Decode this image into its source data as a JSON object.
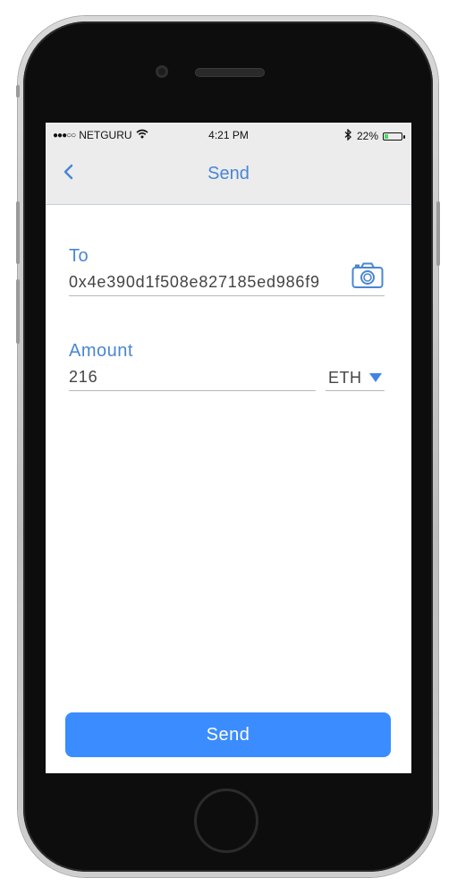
{
  "status_bar": {
    "signal": "●●●○○",
    "carrier": "NETGURU",
    "time": "4:21 PM",
    "battery_percent": "22%",
    "battery_level": 0.22
  },
  "nav": {
    "title": "Send",
    "back_icon": "chevron-left-icon"
  },
  "form": {
    "to": {
      "label": "To",
      "value": "0x4e390d1f508e827185ed986f9",
      "action_icon": "camera-icon"
    },
    "amount": {
      "label": "Amount",
      "value": "216",
      "currency": "ETH",
      "currency_icon": "caret-down-icon"
    }
  },
  "send_button": {
    "label": "Send",
    "color": "#3b8cff"
  },
  "colors": {
    "accent": "#4a86d4",
    "nav_background": "#ececec"
  }
}
